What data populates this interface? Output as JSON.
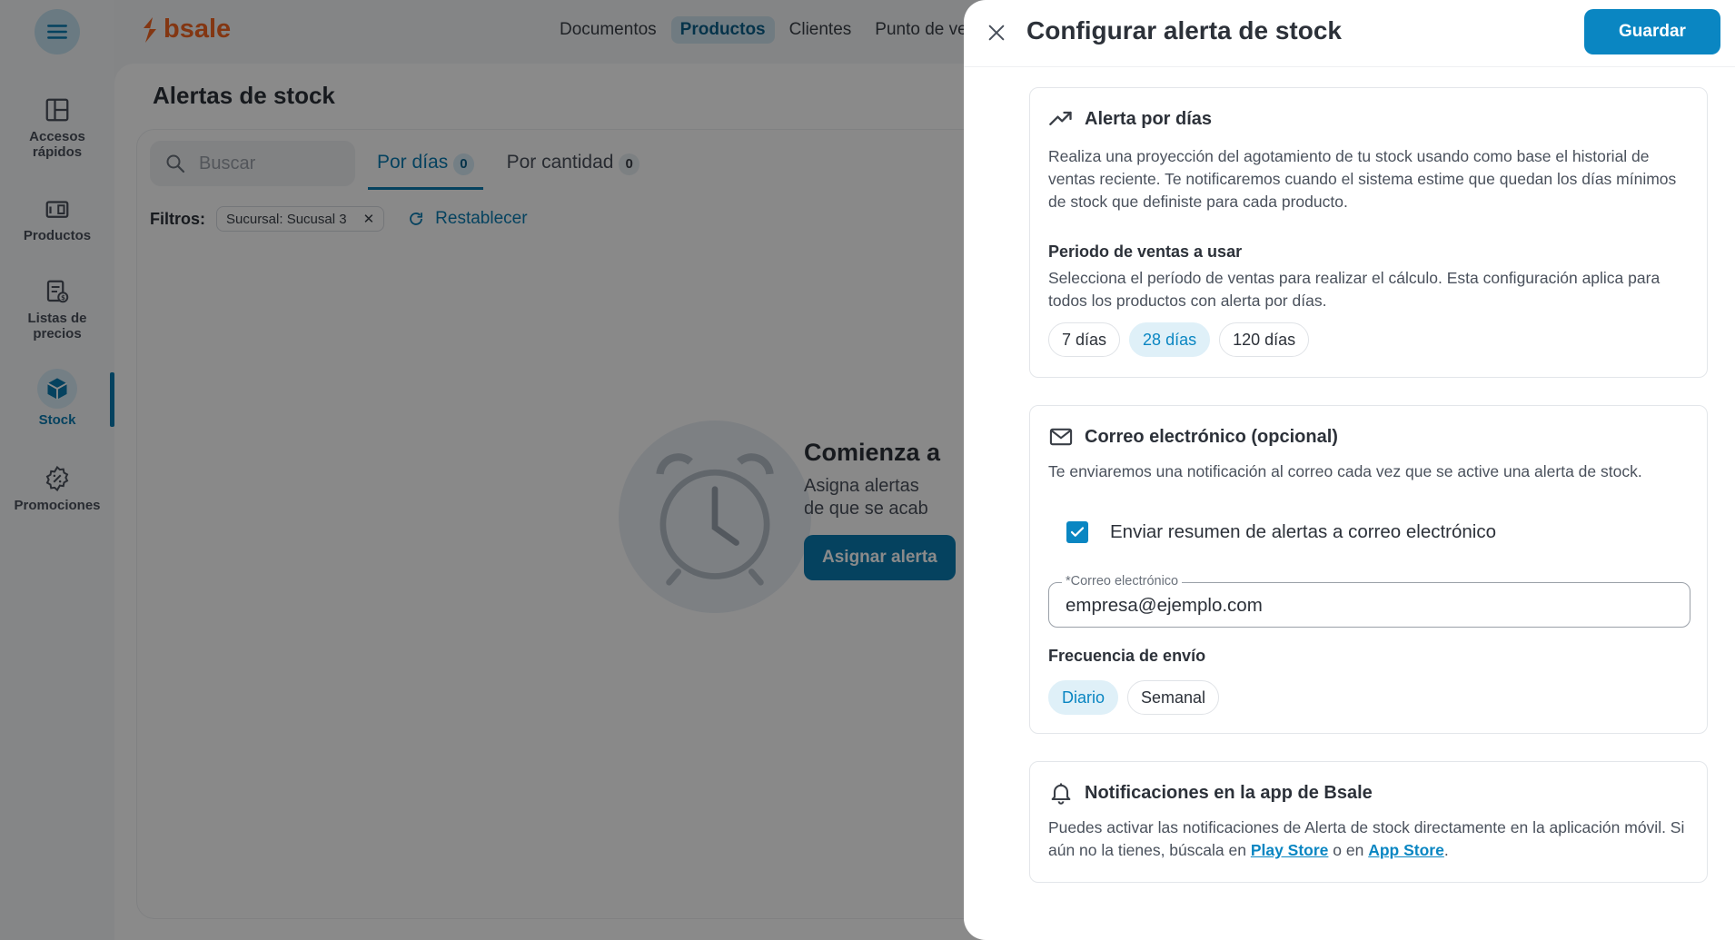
{
  "brand": {
    "name": "bsale",
    "color": "#f26522"
  },
  "accent_color": "#0a86c2",
  "sidebar": {
    "items": [
      {
        "label_line1": "Accesos",
        "label_line2": "rápidos",
        "icon": "layout-icon"
      },
      {
        "label_line1": "Productos",
        "icon": "products-icon"
      },
      {
        "label_line1": "Listas de",
        "label_line2": "precios",
        "icon": "price-list-icon"
      },
      {
        "label_line1": "Stock",
        "icon": "box-icon",
        "active": true
      },
      {
        "label_line1": "Promociones",
        "icon": "promotion-icon"
      }
    ]
  },
  "topnav": {
    "items": [
      "Documentos",
      "Productos",
      "Clientes",
      "Punto de venta"
    ],
    "active": "Productos"
  },
  "page": {
    "title": "Alertas de stock",
    "search_placeholder": "Buscar",
    "tabs": [
      {
        "label": "Por días",
        "count": "0"
      },
      {
        "label": "Por cantidad",
        "count": "0"
      }
    ],
    "filters_label": "Filtros:",
    "filter_chip": "Sucursal: Sucusal 3",
    "reset_label": "Restablecer",
    "empty_title": "Comienza a",
    "empty_desc_line1": "Asigna alertas",
    "empty_desc_line2": "de que se acab",
    "empty_button": "Asignar alerta"
  },
  "drawer": {
    "title": "Configurar alerta de stock",
    "save_label": "Guardar",
    "days_section": {
      "title": "Alerta por días",
      "description": "Realiza una proyección del agotamiento de tu stock usando como base el historial de ventas reciente. Te notificaremos cuando el sistema estime que quedan los días mínimos de stock que definiste para cada producto.",
      "period_title": "Periodo de ventas a usar",
      "period_description": "Selecciona el período de ventas para realizar el cálculo. Esta configuración aplica para todos los productos con alerta por días.",
      "options": [
        "7 días",
        "28 días",
        "120 días"
      ],
      "selected": "28 días"
    },
    "email_section": {
      "title": "Correo electrónico (opcional)",
      "description": "Te enviaremos una notificación al correo cada vez que se active una alerta de stock.",
      "checkbox_label": "Enviar resumen de alertas a correo electrónico",
      "checkbox_checked": true,
      "field_label": "*Correo electrónico",
      "field_value": "empresa@ejemplo.com",
      "frequency_title": "Frecuencia de envío",
      "frequency_options": [
        "Diario",
        "Semanal"
      ],
      "frequency_selected": "Diario"
    },
    "app_section": {
      "title": "Notificaciones en la app de Bsale",
      "text_part1": "Puedes activar las notificaciones de Alerta de stock directamente en la aplicación móvil. Si aún no la tienes, búscala en ",
      "link1": "Play Store",
      "text_part2": " o en ",
      "link2": "App Store",
      "text_part3": "."
    }
  }
}
